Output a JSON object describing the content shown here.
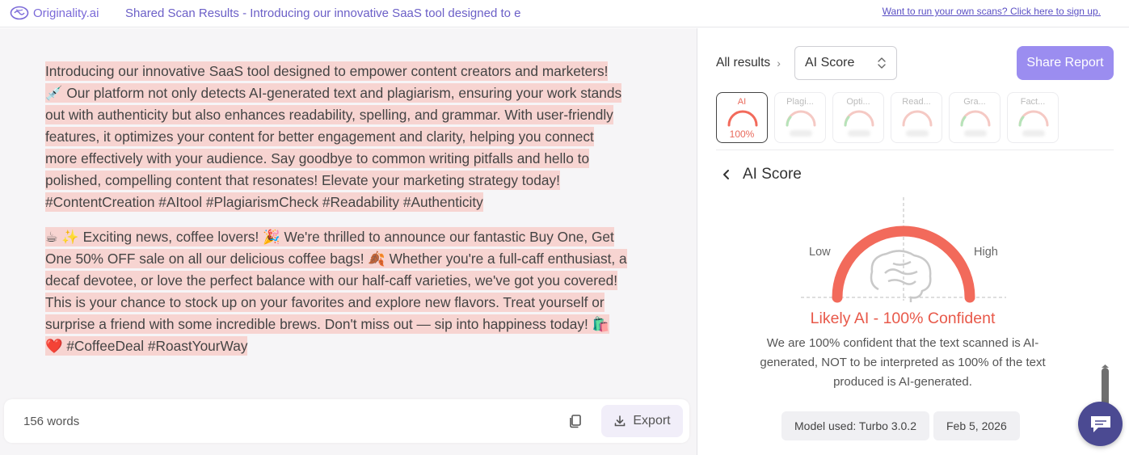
{
  "topbar": {
    "logo_text": "Originality.ai",
    "doc_title": "Shared Scan Results - Introducing our innovative SaaS tool designed to e",
    "signup_link": "Want to run your own scans? Click here to sign up."
  },
  "document": {
    "paragraphs": [
      "Introducing our innovative SaaS tool designed to empower content creators and marketers! 💉 Our platform not only detects AI-generated text and plagiarism, ensuring your work stands out with authenticity but also enhances readability, spelling, and grammar. With user-friendly features, it optimizes your content for better engagement and clarity, helping you connect more effectively with your audience. Say goodbye to common writing pitfalls and hello to polished, compelling content that resonates! Elevate your marketing strategy today! #ContentCreation #AItool #PlagiarismCheck #Readability #Authenticity",
      "☕ ✨ Exciting news, coffee lovers! 🎉 We're thrilled to announce our fantastic Buy One, Get One 50% OFF sale on all our delicious coffee bags! 🍂 Whether you're a full-caff enthusiast, a decaf devotee, or love the perfect balance with our half-caff varieties, we've got you covered! This is your chance to stock up on your favorites and explore new flavors. Treat yourself or surprise a friend with some incredible brews. Don't miss out — sip into happiness today! 🛍️ ❤️ #CoffeeDeal #RoastYourWay"
    ],
    "word_count": "156 words",
    "export_label": "Export"
  },
  "panel": {
    "all_results": "All results",
    "select_value": "AI Score",
    "share_label": "Share Report",
    "tabs": [
      {
        "label": "AI",
        "value": "100%"
      },
      {
        "label": "Plagi..."
      },
      {
        "label": "Opti..."
      },
      {
        "label": "Read..."
      },
      {
        "label": "Gra..."
      },
      {
        "label": "Fact..."
      }
    ],
    "section_title": "AI Score",
    "gauge": {
      "low_label": "Low",
      "high_label": "High",
      "score_percent": 100,
      "color": "#f26a5b"
    },
    "verdict": "Likely AI - 100% Confident",
    "description": "We are 100% confident that the text scanned is AI-generated, NOT to be interpreted as 100% of the text produced is AI-generated.",
    "model_chip": "Model used: Turbo 3.0.2",
    "date_chip": "Feb 5, 2026"
  },
  "colors": {
    "brand": "#7b6ad8",
    "accent_button": "#9b8df0",
    "highlight": "#f7d4d1",
    "ai_red": "#e8594a"
  }
}
